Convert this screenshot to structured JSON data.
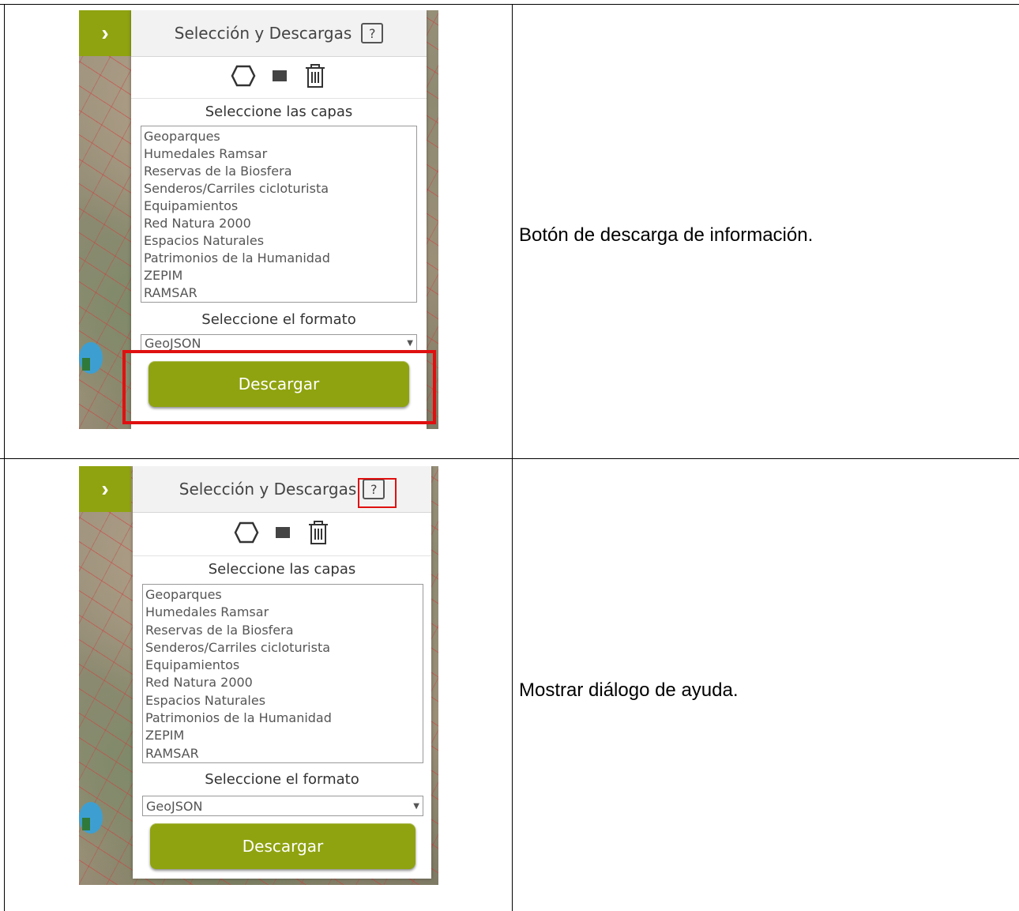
{
  "rows": [
    {
      "description": "Botón de descarga de información.",
      "panel": {
        "toggle_glyph": "›",
        "title": "Selección y Descargas",
        "help_label": "?",
        "icons": [
          "hexagon-icon",
          "square-icon",
          "trash-icon"
        ],
        "layers_label": "Seleccione las capas",
        "layers": [
          "Geoparques",
          "Humedales Ramsar",
          "Reservas de la Biosfera",
          "Senderos/Carriles cicloturista",
          "Equipamientos",
          "Red Natura 2000",
          "Espacios Naturales",
          "Patrimonios de la Humanidad",
          "ZEPIM",
          "RAMSAR"
        ],
        "format_label": "Seleccione el formato",
        "format_value": "GeoJSON",
        "format_arrow": "▼",
        "download_label": "Descargar"
      },
      "highlight": "download-button"
    },
    {
      "description": "Mostrar diálogo de ayuda.",
      "panel": {
        "toggle_glyph": "›",
        "title": "Selección y Descargas",
        "help_label": "?",
        "icons": [
          "hexagon-icon",
          "square-icon",
          "trash-icon"
        ],
        "layers_label": "Seleccione las capas",
        "layers": [
          "Geoparques",
          "Humedales Ramsar",
          "Reservas de la Biosfera",
          "Senderos/Carriles cicloturista",
          "Equipamientos",
          "Red Natura 2000",
          "Espacios Naturales",
          "Patrimonios de la Humanidad",
          "ZEPIM",
          "RAMSAR"
        ],
        "format_label": "Seleccione el formato",
        "format_value": "GeoJSON",
        "format_arrow": "▼",
        "download_label": "Descargar"
      },
      "highlight": "help-button"
    }
  ],
  "colors": {
    "accent": "#8fa310",
    "highlight": "#e01010",
    "water": "#3d9fd1"
  }
}
